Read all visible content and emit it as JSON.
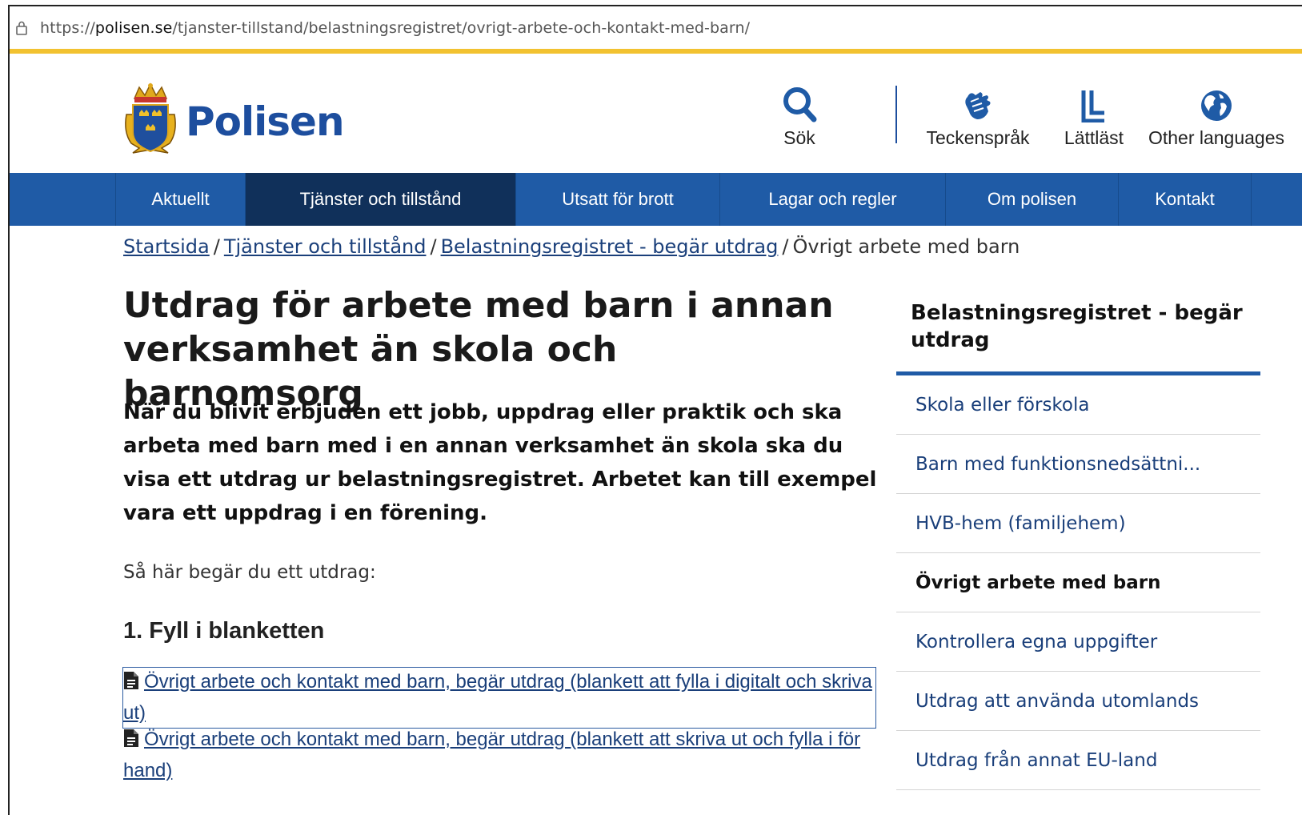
{
  "browser": {
    "url_prefix": "https://",
    "url_host": "polisen.se",
    "url_path": "/tjanster-tillstand/belastningsregistret/ovrigt-arbete-och-kontakt-med-barn/"
  },
  "header": {
    "logo_text": "Polisen",
    "tools": {
      "search": "Sök",
      "sign_language": "Teckenspråk",
      "easy_read": "Lättläst",
      "other_languages": "Other languages"
    }
  },
  "nav": {
    "items": [
      {
        "label": "Aktuellt"
      },
      {
        "label": "Tjänster och tillstånd"
      },
      {
        "label": "Utsatt för brott"
      },
      {
        "label": "Lagar och regler"
      },
      {
        "label": "Om polisen"
      },
      {
        "label": "Kontakt"
      }
    ],
    "active_index": 1
  },
  "breadcrumb": {
    "items": [
      "Startsida",
      "Tjänster och tillstånd",
      "Belastningsregistret - begär utdrag"
    ],
    "current": "Övrigt arbete med barn",
    "separator": "/"
  },
  "main": {
    "title": "Utdrag för arbete med barn i annan verksamhet än skola och barnomsorg",
    "lead": "När du blivit erbjuden ett jobb, uppdrag eller praktik och ska arbeta med barn med i en annan verksamhet än skola ska du visa ett utdrag ur belastningsregistret. Arbetet kan till exempel vara ett uppdrag i en förening.",
    "howto": "Så här begär du ett utdrag:",
    "step1": "1. Fyll i blanketten",
    "links": [
      "Övrigt arbete och kontakt med barn, begär utdrag (blankett att fylla i digitalt och skriva ut)",
      "Övrigt arbete och kontakt med barn, begär utdrag (blankett att skriva ut och fylla i för hand)"
    ]
  },
  "sidebar": {
    "heading": "Belastningsregistret - begär utdrag",
    "items": [
      "Skola eller förskola",
      "Barn med funktionsnedsättni...",
      "HVB-hem (familjehem)",
      "Övrigt arbete med barn",
      "Kontrollera egna uppgifter",
      "Utdrag att använda utomlands",
      "Utdrag från annat EU-land"
    ],
    "current_index": 3
  },
  "colors": {
    "brand_blue": "#1f5ba6",
    "nav_active": "#10305a",
    "accent_yellow": "#f2c230",
    "link": "#1a3f7a"
  },
  "icons": {
    "lock": "lock-icon",
    "search": "search-icon",
    "sign_language": "hand-sign-icon",
    "easy_read": "easy-read-icon",
    "globe": "globe-icon",
    "document": "document-icon",
    "logo": "police-crest-icon"
  }
}
